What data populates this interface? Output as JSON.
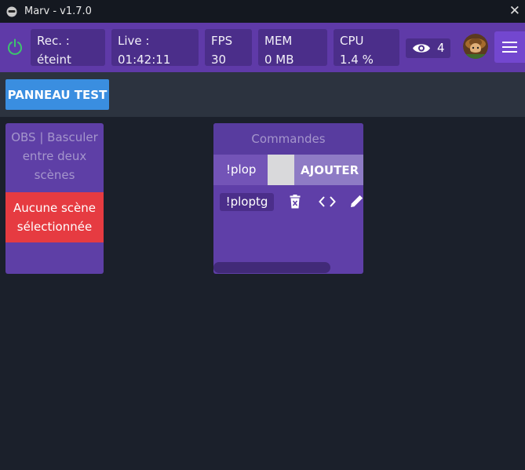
{
  "window": {
    "title": "Marv - v1.7.0"
  },
  "status": {
    "rec": {
      "label": "Rec. :",
      "value": "éteint"
    },
    "live": {
      "label": "Live :",
      "value": "01:42:11"
    },
    "fps": {
      "label": "FPS",
      "value": "30"
    },
    "mem": {
      "label": "MEM",
      "value": "0 MB"
    },
    "cpu": {
      "label": "CPU",
      "value": "1.4 %"
    },
    "viewers": "4",
    "power_color": "#3dc46e"
  },
  "toolbar": {
    "panel_button": "PANNEAU TEST"
  },
  "obs_widget": {
    "title_lines": [
      "OBS | Basculer",
      "entre deux",
      "scènes"
    ],
    "alert_lines": [
      "Aucune scène",
      "sélectionnée"
    ]
  },
  "commands_widget": {
    "title": "Commandes",
    "prefix": "!plop",
    "add_button": "AJOUTER",
    "items": [
      {
        "name": "!ploptg"
      }
    ]
  },
  "colors": {
    "accent": "#5f3aa8",
    "primary_button": "#3a8ee0",
    "danger": "#e63b41",
    "background": "#1b202b"
  }
}
